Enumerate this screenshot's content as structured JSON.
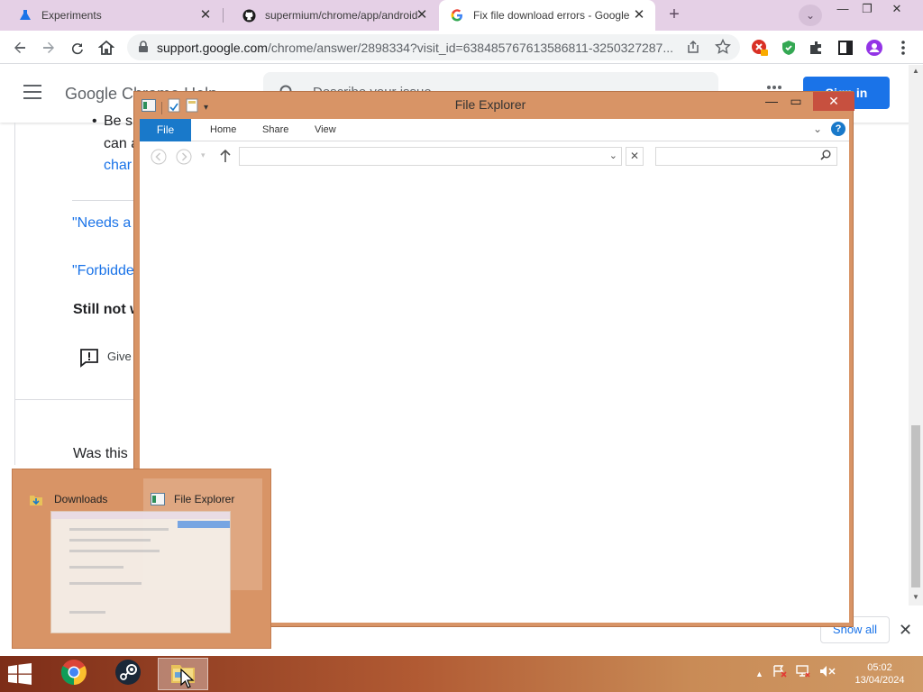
{
  "browser": {
    "tabs": [
      {
        "title": "Experiments",
        "icon": "flask-icon",
        "active": false
      },
      {
        "title": "supermium/chrome/app/android",
        "icon": "github-icon",
        "active": false
      },
      {
        "title": "Fix file download errors - Google",
        "icon": "google-icon",
        "active": true
      }
    ],
    "new_tab_symbol": "+",
    "tab_search_symbol": "⌄",
    "window_controls": {
      "minimize": "—",
      "restore": "❐",
      "close": "✕"
    },
    "url_host": "support.google.com",
    "url_path": "/chrome/answer/2898334?visit_id=638485767613586811-3250327287...",
    "accent_color": "#e5d0e6"
  },
  "help_page": {
    "title": "Google Chrome Help",
    "search_placeholder": "Describe your issue",
    "sign_in": "Sign in",
    "fragments": {
      "bullet1": "Be s",
      "bullet2": "can a",
      "bullet3": "char",
      "link1": "\"Needs a",
      "link2": "\"Forbidde",
      "heading": "Still not w",
      "feedback": "Give",
      "was_this": "Was this"
    },
    "show_all": "Show all",
    "close_symbol": "✕"
  },
  "file_explorer": {
    "title": "File Explorer",
    "ribbon_tabs": [
      "File",
      "Home",
      "Share",
      "View"
    ],
    "path_value": "",
    "search_value": "",
    "controls": {
      "minimize": "—",
      "maximize": "▭",
      "close": "✕"
    },
    "help_symbol": "?",
    "frame_color": "#d89466"
  },
  "thumbnails": [
    {
      "label": "Downloads",
      "icon": "folder-download-icon"
    },
    {
      "label": "File Explorer",
      "icon": "file-explorer-icon"
    }
  ],
  "taskbar": {
    "apps": [
      {
        "name": "chrome",
        "icon": "chrome-icon",
        "active": false
      },
      {
        "name": "steam",
        "icon": "steam-icon",
        "active": false
      },
      {
        "name": "file-explorer",
        "icon": "file-explorer-icon",
        "active": true
      }
    ],
    "clock_time": "05:02",
    "clock_date": "13/04/2024"
  }
}
